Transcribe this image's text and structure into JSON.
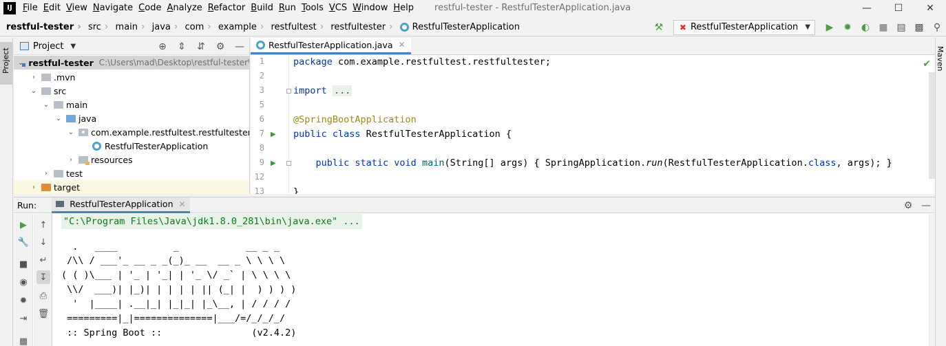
{
  "menubar": {
    "items": [
      "File",
      "Edit",
      "View",
      "Navigate",
      "Code",
      "Analyze",
      "Refactor",
      "Build",
      "Run",
      "Tools",
      "VCS",
      "Window",
      "Help"
    ],
    "window_title": "restful-tester - RestfulTesterApplication.java",
    "logo": "IJ"
  },
  "breadcrumb": {
    "items": [
      "restful-tester",
      "src",
      "main",
      "java",
      "com",
      "example",
      "restfultest",
      "restfultester",
      "RestfulTesterApplication"
    ]
  },
  "toolbar": {
    "run_config": "RestfulTesterApplication"
  },
  "stripes": {
    "project": "Project",
    "maven": "Maven"
  },
  "project_panel": {
    "title": "Project",
    "tree": [
      {
        "label": "restful-tester",
        "path": "C:\\Users\\mad\\Desktop\\restful-tester\\"
      },
      {
        "label": ".mvn"
      },
      {
        "label": "src"
      },
      {
        "label": "main"
      },
      {
        "label": "java"
      },
      {
        "label": "com.example.restfultest.restfultester"
      },
      {
        "label": "RestfulTesterApplication"
      },
      {
        "label": "resources"
      },
      {
        "label": "test"
      },
      {
        "label": "target"
      }
    ]
  },
  "editor": {
    "tab": "RestfulTesterApplication.java",
    "line_numbers": [
      "1",
      "2",
      "3",
      "5",
      "6",
      "7",
      "8",
      "9",
      "12",
      "13"
    ],
    "code": {
      "l1_kw": "package",
      "l1_rest": " com.example.restfultest.restfultester;",
      "l3_kw": "import",
      "l3_folded": "...",
      "l6_ann": "@SpringBootApplication",
      "l7_kw": "public class",
      "l7_rest": " RestfulTesterApplication {",
      "l9_kw": "public static void",
      "l9_fn": "main",
      "l9_args": "(String[] args) ",
      "l9_open": "{",
      "l9_body1": " SpringApplication.",
      "l9_run": "run",
      "l9_body2": "(RestfulTesterApplication.",
      "l9_class": "class",
      "l9_body3": ", args); ",
      "l9_close": "}",
      "l13": "}"
    }
  },
  "run_panel": {
    "label": "Run:",
    "tab": "RestfulTesterApplication",
    "console": {
      "cmd": "\"C:\\Program Files\\Java\\jdk1.8.0_281\\bin\\java.exe\" ...",
      "banner": [
        "  .   ____          _            __ _ _",
        " /\\\\ / ___'_ __ _ _(_)_ __  __ _ \\ \\ \\ \\",
        "( ( )\\___ | '_ | '_| | '_ \\/ _` | \\ \\ \\ \\",
        " \\\\/  ___)| |_)| | | | | || (_| |  ) ) ) )",
        "  '  |____| .__|_| |_|_| |_\\__, | / / / /",
        " =========|_|==============|___/=/_/_/_/",
        " :: Spring Boot ::                (v2.4.2)"
      ]
    }
  }
}
